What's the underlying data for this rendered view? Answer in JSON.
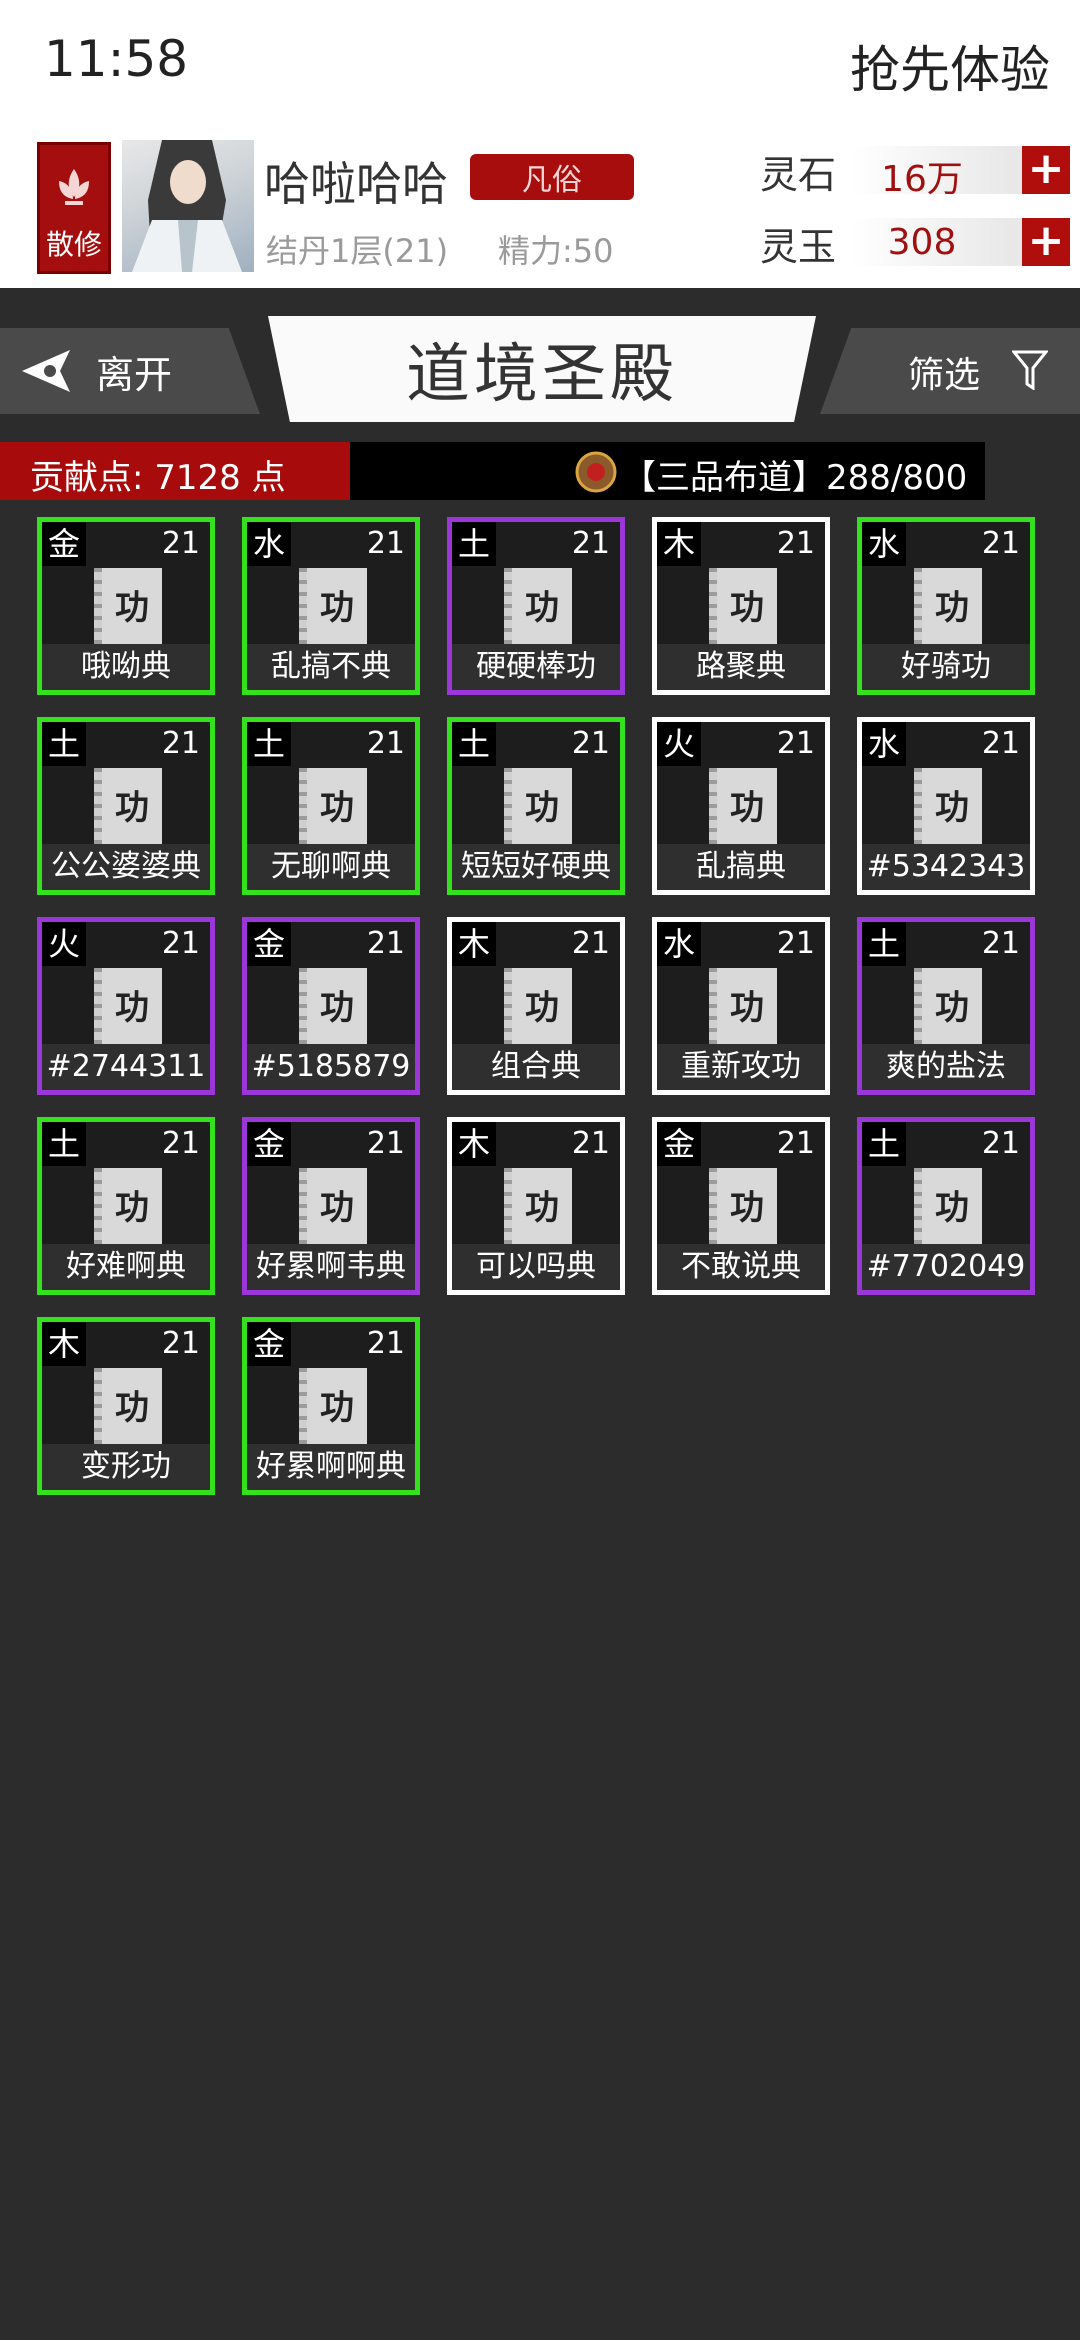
{
  "status_bar": {
    "time": "11:58",
    "right_text": "抢先体验"
  },
  "player": {
    "sect_label": "散修",
    "name": "哈啦哈哈",
    "rank": "凡俗",
    "realm": "结丹1层(21)",
    "energy": "精力:50"
  },
  "currencies": [
    {
      "label": "灵石",
      "value": "16万",
      "plus": "+"
    },
    {
      "label": "灵玉",
      "value": "308",
      "plus": "+"
    }
  ],
  "nav": {
    "leave_label": "离开",
    "title": "道境圣殿",
    "filter_label": "筛选"
  },
  "points": {
    "label": "贡献点: 7128 点",
    "rank_progress": "【三品布道】288/800"
  },
  "colors": {
    "green": "#33e21c",
    "purple": "#9b36d8",
    "white": "#ffffff",
    "accent_red": "#a80b0b"
  },
  "cards": [
    {
      "element": "金",
      "level": "21",
      "name": "哦呦典",
      "rarity": "green",
      "icon_char": "功"
    },
    {
      "element": "水",
      "level": "21",
      "name": "乱搞不典",
      "rarity": "green",
      "icon_char": "功"
    },
    {
      "element": "土",
      "level": "21",
      "name": "硬硬棒功",
      "rarity": "purple",
      "icon_char": "功"
    },
    {
      "element": "木",
      "level": "21",
      "name": "路聚典",
      "rarity": "white",
      "icon_char": "功"
    },
    {
      "element": "水",
      "level": "21",
      "name": "好骑功",
      "rarity": "green",
      "icon_char": "功"
    },
    {
      "element": "土",
      "level": "21",
      "name": "公公婆婆典",
      "rarity": "green",
      "icon_char": "功"
    },
    {
      "element": "土",
      "level": "21",
      "name": "无聊啊典",
      "rarity": "green",
      "icon_char": "功"
    },
    {
      "element": "土",
      "level": "21",
      "name": "短短好硬典",
      "rarity": "green",
      "icon_char": "功"
    },
    {
      "element": "火",
      "level": "21",
      "name": "乱搞典",
      "rarity": "white",
      "icon_char": "功"
    },
    {
      "element": "水",
      "level": "21",
      "name": "#5342343",
      "rarity": "white",
      "icon_char": "功"
    },
    {
      "element": "火",
      "level": "21",
      "name": "#2744311",
      "rarity": "purple",
      "icon_char": "功"
    },
    {
      "element": "金",
      "level": "21",
      "name": "#5185879",
      "rarity": "purple",
      "icon_char": "功"
    },
    {
      "element": "木",
      "level": "21",
      "name": "组合典",
      "rarity": "white",
      "icon_char": "功"
    },
    {
      "element": "水",
      "level": "21",
      "name": "重新攻功",
      "rarity": "white",
      "icon_char": "功"
    },
    {
      "element": "土",
      "level": "21",
      "name": "爽的盐法",
      "rarity": "purple",
      "icon_char": "功"
    },
    {
      "element": "土",
      "level": "21",
      "name": "好难啊典",
      "rarity": "green",
      "icon_char": "功"
    },
    {
      "element": "金",
      "level": "21",
      "name": "好累啊韦典",
      "rarity": "purple",
      "icon_char": "功"
    },
    {
      "element": "木",
      "level": "21",
      "name": "可以吗典",
      "rarity": "white",
      "icon_char": "功"
    },
    {
      "element": "金",
      "level": "21",
      "name": "不敢说典",
      "rarity": "white",
      "icon_char": "功"
    },
    {
      "element": "土",
      "level": "21",
      "name": "#7702049",
      "rarity": "purple",
      "icon_char": "功"
    },
    {
      "element": "木",
      "level": "21",
      "name": "变形功",
      "rarity": "green",
      "icon_char": "功"
    },
    {
      "element": "金",
      "level": "21",
      "name": "好累啊啊典",
      "rarity": "green",
      "icon_char": "功"
    }
  ]
}
